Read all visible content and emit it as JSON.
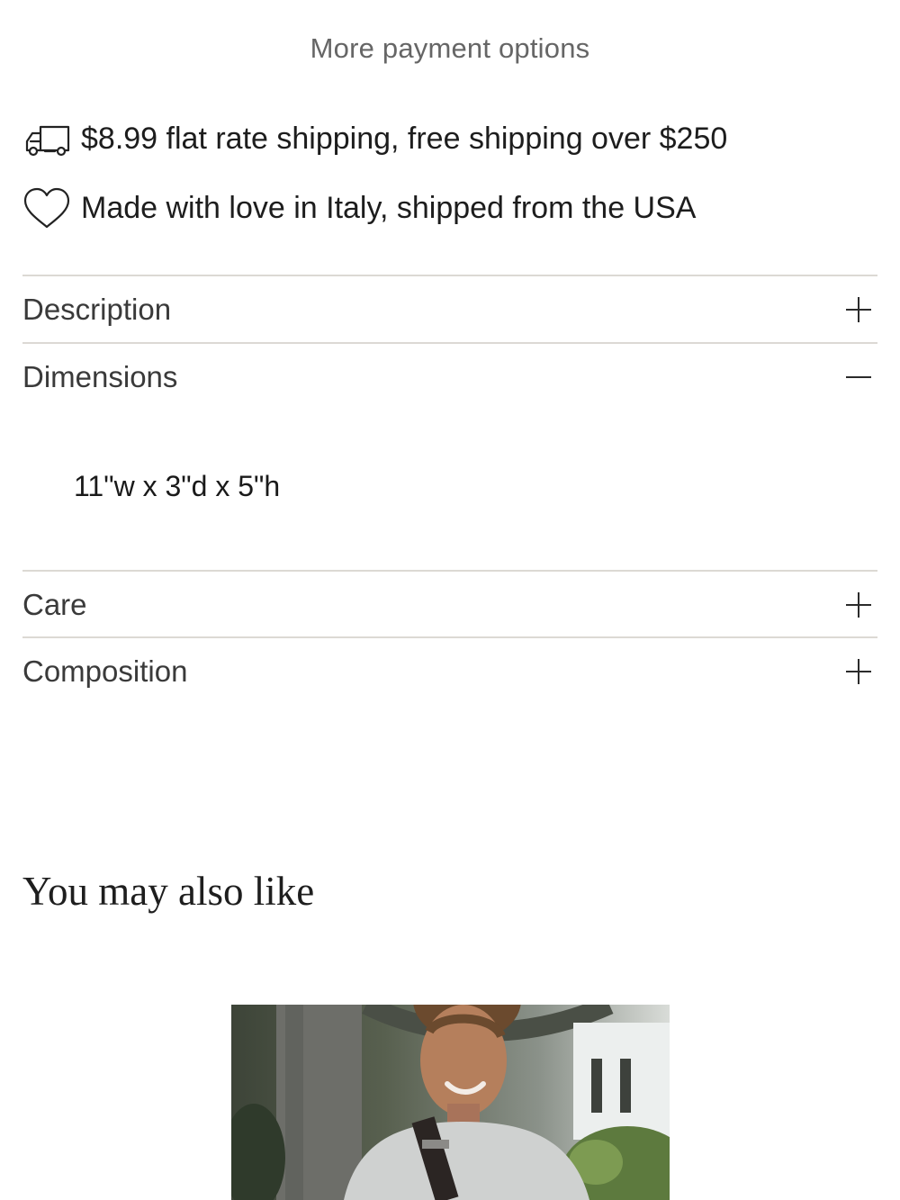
{
  "payment": {
    "more_options_label": "More payment options"
  },
  "info": {
    "shipping": {
      "icon": "delivery-truck-icon",
      "text": "$8.99 flat rate shipping, free shipping over $250"
    },
    "origin": {
      "icon": "heart-icon",
      "text": "Made with love in Italy, shipped from the USA"
    }
  },
  "accordion": {
    "description": {
      "label": "Description",
      "state": "collapsed",
      "toggle_icon": "plus-icon"
    },
    "dimensions": {
      "label": "Dimensions",
      "state": "expanded",
      "toggle_icon": "minus-icon",
      "content": "11\"w x 3\"d x 5\"h"
    },
    "care": {
      "label": "Care",
      "state": "collapsed",
      "toggle_icon": "plus-icon"
    },
    "composition": {
      "label": "Composition",
      "state": "collapsed",
      "toggle_icon": "plus-icon"
    }
  },
  "recommendations": {
    "heading": "You may also like"
  },
  "colors": {
    "divider": "#dcd9d4",
    "muted_text": "#666666",
    "text": "#1d1d1d"
  }
}
